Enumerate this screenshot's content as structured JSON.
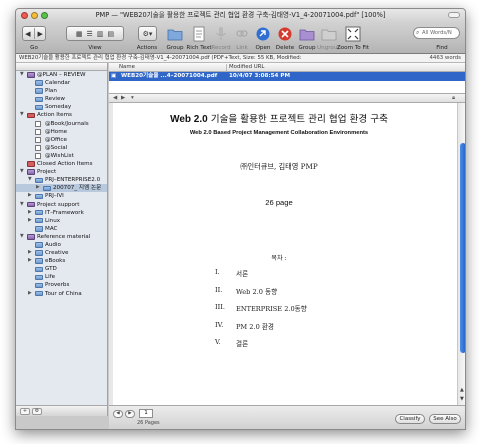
{
  "window": {
    "title": "PMP — \"WEB20기술을 활용한 프로젝트 관리 협업 환경 구축-김태영-V1_4-20071004.pdf\" [100%]"
  },
  "toolbar": {
    "go_label": "Go",
    "view_label": "View",
    "actions_label": "Actions",
    "group_label": "Group",
    "rich_text_label": "Rich Text",
    "record_label": "Record",
    "link_label": "Link",
    "open_label": "Open",
    "delete_label": "Delete",
    "group2_label": "Group",
    "ungroup_label": "Ungroup",
    "zoom_label": "Zoom To Fit",
    "find_label": "Find",
    "search_placeholder": "All Words/N"
  },
  "pathbar": {
    "text": "WEB20기술을 활용한 프로젝트 관리 협업 환경 구축-김태영-V1_4-20071004.pdf (PDF+Text, Size: 55 KB, Modified:",
    "words": "4463 words"
  },
  "sidebar": {
    "items": [
      {
        "label": "@PLAN – REVIEW",
        "indent": 0,
        "tri": "▼",
        "icon": "group",
        "selected": false
      },
      {
        "label": "Calendar",
        "indent": 1,
        "tri": "",
        "icon": "folder",
        "selected": false
      },
      {
        "label": "Plan",
        "indent": 1,
        "tri": "",
        "icon": "folder",
        "selected": false
      },
      {
        "label": "Review",
        "indent": 1,
        "tri": "",
        "icon": "folder",
        "selected": false
      },
      {
        "label": "Someday",
        "indent": 1,
        "tri": "",
        "icon": "folder",
        "selected": false
      },
      {
        "label": "Action Items",
        "indent": 0,
        "tri": "▼",
        "icon": "action",
        "selected": false
      },
      {
        "label": "@Book/Journals",
        "indent": 1,
        "tri": "",
        "icon": "checkbox",
        "selected": false
      },
      {
        "label": "@Home",
        "indent": 1,
        "tri": "",
        "icon": "checkbox",
        "selected": false
      },
      {
        "label": "@Office",
        "indent": 1,
        "tri": "",
        "icon": "checkbox",
        "selected": false
      },
      {
        "label": "@Social",
        "indent": 1,
        "tri": "",
        "icon": "checkbox",
        "selected": false
      },
      {
        "label": "@WishList",
        "indent": 1,
        "tri": "",
        "icon": "checkbox",
        "selected": false
      },
      {
        "label": "Closed Action Items",
        "indent": 0,
        "tri": "",
        "icon": "action",
        "selected": false
      },
      {
        "label": "Project",
        "indent": 0,
        "tri": "▼",
        "icon": "group",
        "selected": false
      },
      {
        "label": "PRJ–ENTERPRISE2.0",
        "indent": 1,
        "tri": "▼",
        "icon": "folder",
        "selected": false
      },
      {
        "label": "200707_ 지엠 논문",
        "indent": 2,
        "tri": "▶",
        "icon": "folder",
        "selected": true
      },
      {
        "label": "PRJ–IVI",
        "indent": 1,
        "tri": "▶",
        "icon": "folder",
        "selected": false
      },
      {
        "label": "Project support",
        "indent": 0,
        "tri": "▼",
        "icon": "group",
        "selected": false
      },
      {
        "label": "IT–Framework",
        "indent": 1,
        "tri": "▶",
        "icon": "folder",
        "selected": false
      },
      {
        "label": "Linux",
        "indent": 1,
        "tri": "▶",
        "icon": "folder",
        "selected": false
      },
      {
        "label": "MAC",
        "indent": 1,
        "tri": "",
        "icon": "folder",
        "selected": false
      },
      {
        "label": "Reference material",
        "indent": 0,
        "tri": "▼",
        "icon": "group",
        "selected": false
      },
      {
        "label": "Audio",
        "indent": 1,
        "tri": "",
        "icon": "folder",
        "selected": false
      },
      {
        "label": "Creative",
        "indent": 1,
        "tri": "▶",
        "icon": "folder",
        "selected": false
      },
      {
        "label": "eBooks",
        "indent": 1,
        "tri": "▶",
        "icon": "folder",
        "selected": false
      },
      {
        "label": "GTD",
        "indent": 1,
        "tri": "",
        "icon": "folder",
        "selected": false
      },
      {
        "label": "Life",
        "indent": 1,
        "tri": "",
        "icon": "folder",
        "selected": false
      },
      {
        "label": "Proverbs",
        "indent": 1,
        "tri": "",
        "icon": "folder",
        "selected": false
      },
      {
        "label": "Tour of China",
        "indent": 1,
        "tri": "▶",
        "icon": "folder",
        "selected": false
      }
    ]
  },
  "list": {
    "col_name": "Name",
    "col_modified": "Modified URL",
    "row_name": "WEB20기술을 ...4–20071004.pdf",
    "row_modified": "10/4/07 3:08:54 PM"
  },
  "document": {
    "title_bold": "Web 2.0",
    "title_rest": "기술을 활용한 프로젝트 관리 협업 환경 구축",
    "subtitle": "Web 2.0 Based Project Management Collaboration Environments",
    "author": "㈜인터큐브, 김태영 PMP",
    "pages": "26 page",
    "toc_title": "목차 :",
    "toc": [
      {
        "num": "I.",
        "label": "서론"
      },
      {
        "num": "II.",
        "label": "Web 2.0 동향"
      },
      {
        "num": "III.",
        "label": "ENTERPRISE 2.0동향"
      },
      {
        "num": "IV.",
        "label": "PM 2.0 환경"
      },
      {
        "num": "V.",
        "label": "결론"
      }
    ]
  },
  "bottom": {
    "page_value": "1",
    "page_count": "26 Pages",
    "classify_label": "Classify",
    "see_also_label": "See Also"
  },
  "colors": {
    "selection": "#2f66c8",
    "sidebar_bg": "#e4e9f0",
    "scroll_thumb": "#2b6fd6"
  }
}
